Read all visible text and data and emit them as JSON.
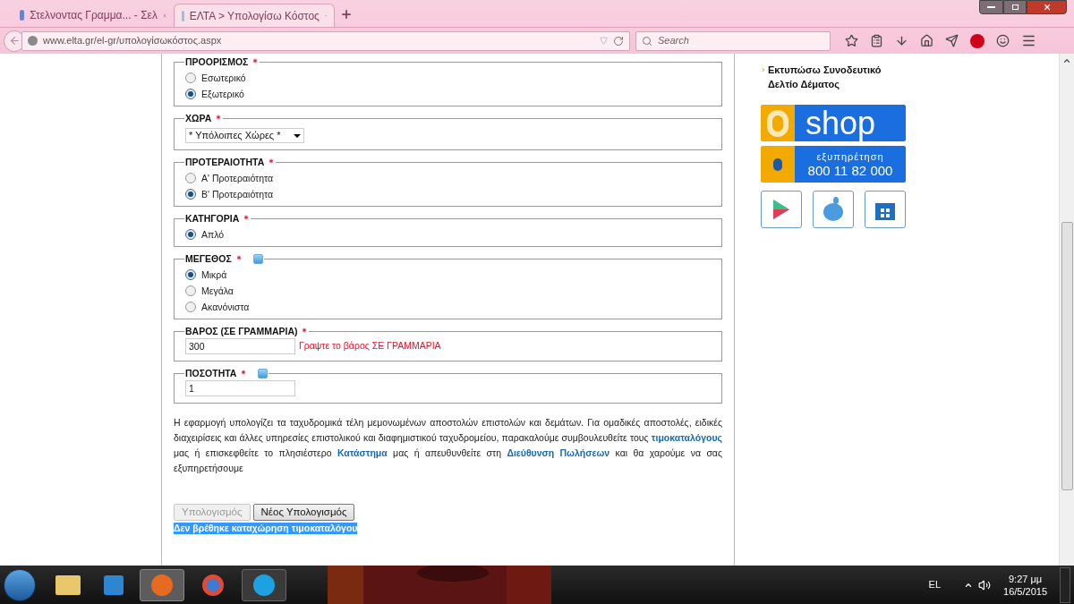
{
  "browser": {
    "tabs": [
      {
        "title": "Στελνοντας Γραμμα... - Σελ",
        "selected": false
      },
      {
        "title": "ΕΛΤΑ > Υπολογίσω Κόστος",
        "selected": true
      }
    ],
    "url": "www.elta.gr/el-gr/υπολογίσωκόστος.aspx",
    "search_placeholder": "Search"
  },
  "form": {
    "sections": [
      {
        "label": "ΠΡΟΟΡΙΣΜΟΣ",
        "required": true,
        "info": false,
        "kind": "radio",
        "options": [
          {
            "label": "Εσωτερικό",
            "selected": false
          },
          {
            "label": "Εξωτερικό",
            "selected": true
          }
        ]
      },
      {
        "label": "ΧΩΡΑ",
        "required": true,
        "info": false,
        "kind": "select",
        "value": "* Υπόλοιπες Χώρες *"
      },
      {
        "label": "ΠΡΟΤΕΡΑΙΟΤΗΤΑ",
        "required": true,
        "info": false,
        "kind": "radio",
        "options": [
          {
            "label": "Α' Προτεραιότητα",
            "selected": false
          },
          {
            "label": "Β' Προτεραιότητα",
            "selected": true
          }
        ]
      },
      {
        "label": "ΚΑΤΗΓΟΡΙΑ",
        "required": true,
        "info": false,
        "kind": "radio",
        "options": [
          {
            "label": "Απλό",
            "selected": true
          }
        ]
      },
      {
        "label": "ΜΕΓΕΘΟΣ",
        "required": true,
        "info": true,
        "kind": "radio",
        "options": [
          {
            "label": "Μικρά",
            "selected": true
          },
          {
            "label": "Μεγάλα",
            "selected": false
          },
          {
            "label": "Ακανόνιστα",
            "selected": false
          }
        ]
      },
      {
        "label": "ΒΑΡΟΣ (ΣΕ ΓΡΑΜΜΑΡΙΑ)",
        "required": true,
        "info": false,
        "kind": "input",
        "value": "300",
        "hint": "Γραψτε το βάρος ΣΕ ΓΡΑΜΜΑΡΙΑ"
      },
      {
        "label": "ΠΟΣΟΤΗΤΑ",
        "required": true,
        "info": true,
        "kind": "input",
        "value": "1"
      }
    ],
    "paragraph": [
      {
        "kind": "text",
        "text": "Η εφαρμογή υπολογίζει τα ταχυδρομικά τέλη μεμονωμένων αποστολών επιστολών και δεμάτων. Για ομαδικές αποστολές, ειδικές διαχειρίσεις και άλλες υπηρεσίες επιστολικού και διαφημιστικού ταχυδρομείου, παρακαλούμε συμβουλευθείτε τους "
      },
      {
        "kind": "link",
        "text": "τιμοκαταλόγους"
      },
      {
        "kind": "text",
        "text": " μας ή επισκεφθείτε το πλησιέστερο "
      },
      {
        "kind": "link",
        "text": "Κατάστημα"
      },
      {
        "kind": "text",
        "text": " μας ή απευθυνθείτε στη "
      },
      {
        "kind": "link",
        "text": "Διεύθυνση Πωλήσεων"
      },
      {
        "kind": "text",
        "text": " και θα χαρούμε να σας εξυπηρετήσουμε"
      }
    ],
    "buttons": [
      {
        "label": "Υπολογισμός",
        "disabled": true
      },
      {
        "label": "Νέος Υπολογισμός",
        "disabled": false
      }
    ],
    "message": "Δεν βρέθηκε καταχώρηση τιμοκαταλόγου"
  },
  "sidebar": {
    "links": [
      "Εκτυπώσω Συνοδευτικό Δελτίο Δέματος"
    ],
    "eshop": "shop",
    "service_label": "εξυπηρέτηση",
    "phone": "800 11 82 000"
  },
  "taskbar": {
    "language": "EL",
    "time": "9:27 μμ",
    "date": "16/5/2015"
  }
}
